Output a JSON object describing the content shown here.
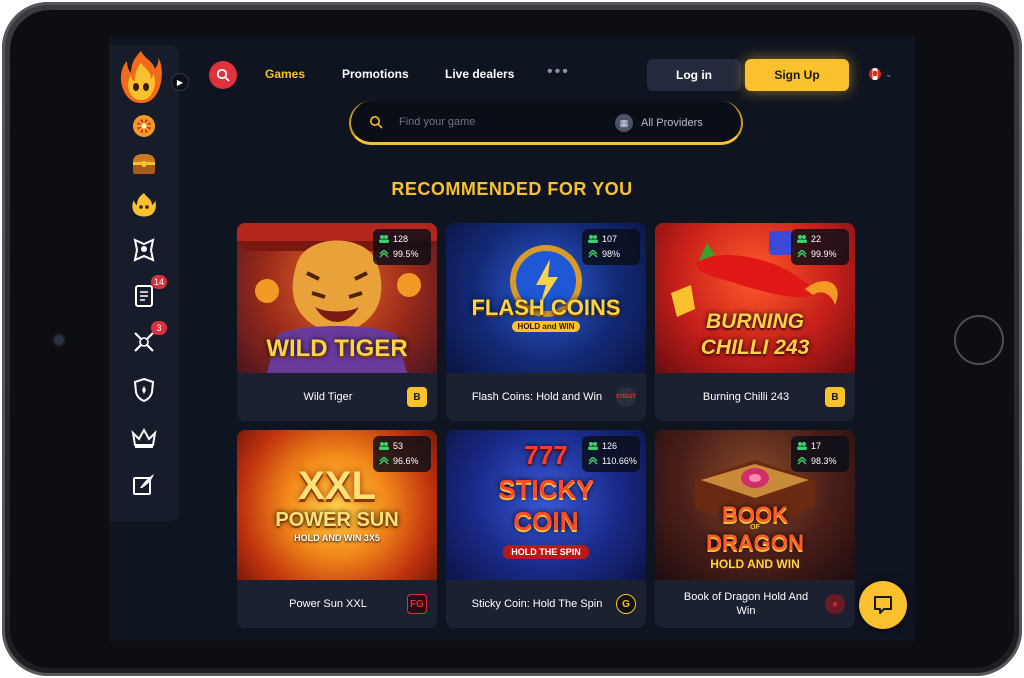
{
  "topnav": {
    "games": "Games",
    "promotions": "Promotions",
    "live_dealers": "Live dealers",
    "more": "•••",
    "login": "Log in",
    "signup": "Sign Up"
  },
  "sidebar": {
    "items": [
      {
        "icon": "wheel-icon",
        "badge": ""
      },
      {
        "icon": "treasure-chest-icon",
        "badge": ""
      },
      {
        "icon": "fire-mascot-icon",
        "badge": ""
      },
      {
        "icon": "warrior-icon",
        "badge": ""
      },
      {
        "icon": "scroll-icon",
        "badge": "14"
      },
      {
        "icon": "crossed-swords-icon",
        "badge": "3"
      },
      {
        "icon": "shield-icon",
        "badge": ""
      },
      {
        "icon": "crown-icon",
        "badge": ""
      },
      {
        "icon": "quill-icon",
        "badge": ""
      }
    ]
  },
  "search": {
    "placeholder": "Find your game",
    "providers_label": "All Providers"
  },
  "section_title": "RECOMMENDED FOR YOU",
  "games": [
    {
      "name": "Wild Tiger",
      "art_title": "WILD TIGER",
      "players": "128",
      "rtp": "99.5%",
      "provider": "B"
    },
    {
      "name": "Flash Coins: Hold and Win",
      "art_title": "FLASH COINS",
      "art_sub": "HOLD and WIN",
      "players": "107",
      "rtp": "98%",
      "provider": "STREET"
    },
    {
      "name": "Burning Chilli 243",
      "art_title": "BURNING",
      "art_sub": "CHILLI 243",
      "players": "22",
      "rtp": "99.9%",
      "provider": "B"
    },
    {
      "name": "Power Sun XXL",
      "art_title": "XXL",
      "art_sub": "POWER SUN",
      "art_sub2": "HOLD AND WIN 3X5",
      "players": "53",
      "rtp": "96.6%",
      "provider": "FG"
    },
    {
      "name": "Sticky Coin: Hold The Spin",
      "art_title": "STICKY",
      "art_sub": "COIN",
      "art_sub2": "HOLD THE SPIN",
      "art_top": "777",
      "players": "126",
      "rtp": "110.66%",
      "provider": "G"
    },
    {
      "name": "Book of Dragon Hold And Win",
      "art_title": "BOOK",
      "art_sub": "DRAGON",
      "art_sub2": "HOLD AND WIN",
      "art_of": "OF",
      "players": "17",
      "rtp": "98.3%",
      "provider": "●"
    }
  ],
  "colors": {
    "accent": "#f9c12e",
    "background": "#0f1421",
    "card": "#1b2130",
    "search_red": "#e0323c"
  }
}
